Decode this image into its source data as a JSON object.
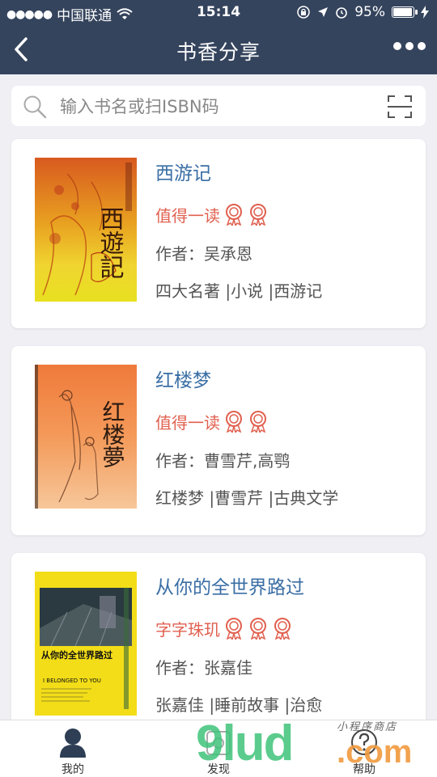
{
  "status_bar": {
    "carrier": "中国联通",
    "time": "15:14",
    "battery": "95%"
  },
  "nav": {
    "title": "书香分享"
  },
  "search": {
    "placeholder": "输入书名或扫ISBN码"
  },
  "books": [
    {
      "title": "西游记",
      "rating_text": "值得一读",
      "awards": 2,
      "author": "作者：吴承恩",
      "tags": "四大名著 |小说 |西游记",
      "cover_text": "西遊記"
    },
    {
      "title": "红楼梦",
      "rating_text": "值得一读",
      "awards": 2,
      "author": "作者：曹雪芹,高鹗",
      "tags": "红楼梦 |曹雪芹 |古典文学",
      "cover_text": "红楼夢"
    },
    {
      "title": "从你的全世界路过",
      "rating_text": "字字珠玑",
      "awards": 3,
      "author": "作者：张嘉佳",
      "tags": "张嘉佳 |睡前故事 |治愈",
      "cover_text": "从你的全世界路过",
      "cover_sub": "I BELONGED TO YOU"
    }
  ],
  "tabs": [
    {
      "label": "我的"
    },
    {
      "label": "发现"
    },
    {
      "label": "帮助"
    }
  ],
  "watermark": {
    "main": "9lud",
    "domain": ".com",
    "sub": "小程序商店"
  },
  "colors": {
    "nav_bg": "#35445d",
    "title_blue": "#3a6ea5",
    "rating_red": "#e0604f",
    "page_bg": "#efeff4"
  }
}
